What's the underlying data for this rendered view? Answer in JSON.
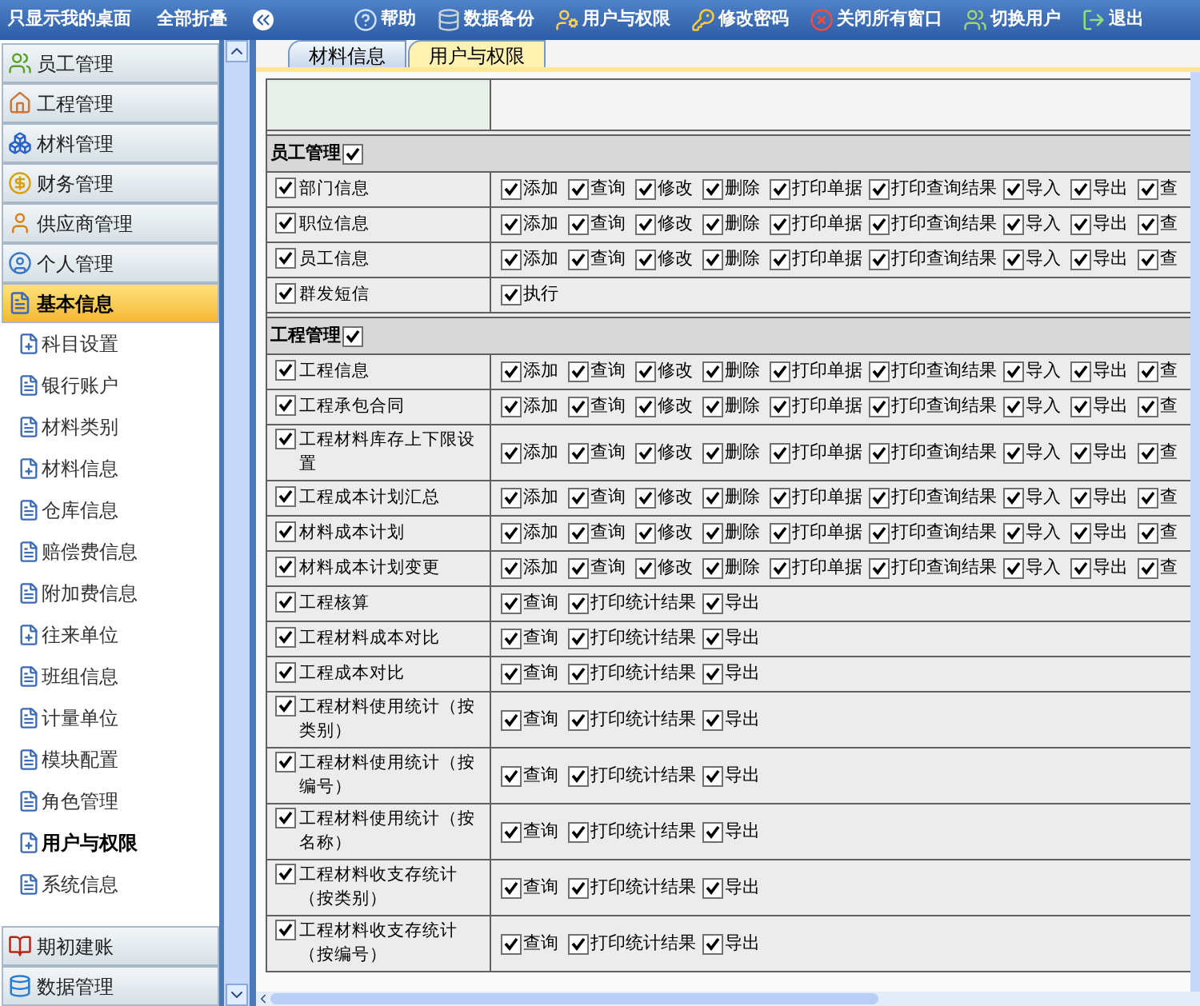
{
  "toolbar": {
    "left": [
      {
        "label": "只显示我的桌面"
      },
      {
        "label": "全部折叠"
      }
    ],
    "actions": [
      {
        "label": "帮助"
      },
      {
        "label": "数据备份"
      },
      {
        "label": "用户与权限"
      },
      {
        "label": "修改密码"
      },
      {
        "label": "关闭所有窗口"
      },
      {
        "label": "切换用户"
      },
      {
        "label": "退出"
      }
    ]
  },
  "sidebar": {
    "groups": [
      {
        "label": "员工管理",
        "expanded": false
      },
      {
        "label": "工程管理",
        "expanded": false
      },
      {
        "label": "材料管理",
        "expanded": false
      },
      {
        "label": "财务管理",
        "expanded": false
      },
      {
        "label": "供应商管理",
        "expanded": false
      },
      {
        "label": "个人管理",
        "expanded": false
      },
      {
        "label": "基本信息",
        "expanded": true,
        "children": [
          {
            "label": "科目设置",
            "kind": "doc-plus",
            "selected": false
          },
          {
            "label": "银行账户",
            "kind": "doc",
            "selected": false
          },
          {
            "label": "材料类别",
            "kind": "doc",
            "selected": false
          },
          {
            "label": "材料信息",
            "kind": "doc-plus",
            "selected": false
          },
          {
            "label": "仓库信息",
            "kind": "doc",
            "selected": false
          },
          {
            "label": "赔偿费信息",
            "kind": "doc",
            "selected": false
          },
          {
            "label": "附加费信息",
            "kind": "doc",
            "selected": false
          },
          {
            "label": "往来单位",
            "kind": "doc-plus",
            "selected": false
          },
          {
            "label": "班组信息",
            "kind": "doc",
            "selected": false
          },
          {
            "label": "计量单位",
            "kind": "doc",
            "selected": false
          },
          {
            "label": "模块配置",
            "kind": "doc",
            "selected": false
          },
          {
            "label": "角色管理",
            "kind": "doc",
            "selected": false
          },
          {
            "label": "用户与权限",
            "kind": "doc-plus",
            "selected": true
          },
          {
            "label": "系统信息",
            "kind": "doc",
            "selected": false
          }
        ]
      },
      {
        "label": "期初建账",
        "expanded": false
      },
      {
        "label": "数据管理",
        "expanded": false
      }
    ]
  },
  "tabs": [
    {
      "label": "材料信息",
      "selected": false
    },
    {
      "label": "用户与权限",
      "selected": true
    }
  ],
  "permissions": {
    "sections": [
      {
        "title": "员工管理",
        "checked": true,
        "rows": [
          {
            "label": "部门信息",
            "checked": true,
            "actions": [
              {
                "label": "添加",
                "checked": true
              },
              {
                "label": "查询",
                "checked": true
              },
              {
                "label": "修改",
                "checked": true
              },
              {
                "label": "删除",
                "checked": true
              },
              {
                "label": "打印单据",
                "checked": true
              },
              {
                "label": "打印查询结果",
                "checked": true
              },
              {
                "label": "导入",
                "checked": true
              },
              {
                "label": "导出",
                "checked": true
              },
              {
                "label": "查",
                "checked": true
              }
            ]
          },
          {
            "label": "职位信息",
            "checked": true,
            "actions": [
              {
                "label": "添加",
                "checked": true
              },
              {
                "label": "查询",
                "checked": true
              },
              {
                "label": "修改",
                "checked": true
              },
              {
                "label": "删除",
                "checked": true
              },
              {
                "label": "打印单据",
                "checked": true
              },
              {
                "label": "打印查询结果",
                "checked": true
              },
              {
                "label": "导入",
                "checked": true
              },
              {
                "label": "导出",
                "checked": true
              },
              {
                "label": "查",
                "checked": true
              }
            ]
          },
          {
            "label": "员工信息",
            "checked": true,
            "actions": [
              {
                "label": "添加",
                "checked": true
              },
              {
                "label": "查询",
                "checked": true
              },
              {
                "label": "修改",
                "checked": true
              },
              {
                "label": "删除",
                "checked": true
              },
              {
                "label": "打印单据",
                "checked": true
              },
              {
                "label": "打印查询结果",
                "checked": true
              },
              {
                "label": "导入",
                "checked": true
              },
              {
                "label": "导出",
                "checked": true
              },
              {
                "label": "查",
                "checked": true
              }
            ]
          },
          {
            "label": "群发短信",
            "checked": true,
            "actions": [
              {
                "label": "执行",
                "checked": true
              }
            ]
          }
        ]
      },
      {
        "title": "工程管理",
        "checked": true,
        "rows": [
          {
            "label": "工程信息",
            "checked": true,
            "actions": [
              {
                "label": "添加",
                "checked": true
              },
              {
                "label": "查询",
                "checked": true
              },
              {
                "label": "修改",
                "checked": true
              },
              {
                "label": "删除",
                "checked": true
              },
              {
                "label": "打印单据",
                "checked": true
              },
              {
                "label": "打印查询结果",
                "checked": true
              },
              {
                "label": "导入",
                "checked": true
              },
              {
                "label": "导出",
                "checked": true
              },
              {
                "label": "查",
                "checked": true
              }
            ]
          },
          {
            "label": "工程承包合同",
            "checked": true,
            "actions": [
              {
                "label": "添加",
                "checked": true
              },
              {
                "label": "查询",
                "checked": true
              },
              {
                "label": "修改",
                "checked": true
              },
              {
                "label": "删除",
                "checked": true
              },
              {
                "label": "打印单据",
                "checked": true
              },
              {
                "label": "打印查询结果",
                "checked": true
              },
              {
                "label": "导入",
                "checked": true
              },
              {
                "label": "导出",
                "checked": true
              },
              {
                "label": "查",
                "checked": true
              }
            ]
          },
          {
            "label": "工程材料库存上下限设置",
            "checked": true,
            "actions": [
              {
                "label": "添加",
                "checked": true
              },
              {
                "label": "查询",
                "checked": true
              },
              {
                "label": "修改",
                "checked": true
              },
              {
                "label": "删除",
                "checked": true
              },
              {
                "label": "打印单据",
                "checked": true
              },
              {
                "label": "打印查询结果",
                "checked": true
              },
              {
                "label": "导入",
                "checked": true
              },
              {
                "label": "导出",
                "checked": true
              },
              {
                "label": "查",
                "checked": true
              }
            ]
          },
          {
            "label": "工程成本计划汇总",
            "checked": true,
            "actions": [
              {
                "label": "添加",
                "checked": true
              },
              {
                "label": "查询",
                "checked": true
              },
              {
                "label": "修改",
                "checked": true
              },
              {
                "label": "删除",
                "checked": true
              },
              {
                "label": "打印单据",
                "checked": true
              },
              {
                "label": "打印查询结果",
                "checked": true
              },
              {
                "label": "导入",
                "checked": true
              },
              {
                "label": "导出",
                "checked": true
              },
              {
                "label": "查",
                "checked": true
              }
            ]
          },
          {
            "label": "材料成本计划",
            "checked": true,
            "actions": [
              {
                "label": "添加",
                "checked": true
              },
              {
                "label": "查询",
                "checked": true
              },
              {
                "label": "修改",
                "checked": true
              },
              {
                "label": "删除",
                "checked": true
              },
              {
                "label": "打印单据",
                "checked": true
              },
              {
                "label": "打印查询结果",
                "checked": true
              },
              {
                "label": "导入",
                "checked": true
              },
              {
                "label": "导出",
                "checked": true
              },
              {
                "label": "查",
                "checked": true
              }
            ]
          },
          {
            "label": "材料成本计划变更",
            "checked": true,
            "actions": [
              {
                "label": "添加",
                "checked": true
              },
              {
                "label": "查询",
                "checked": true
              },
              {
                "label": "修改",
                "checked": true
              },
              {
                "label": "删除",
                "checked": true
              },
              {
                "label": "打印单据",
                "checked": true
              },
              {
                "label": "打印查询结果",
                "checked": true
              },
              {
                "label": "导入",
                "checked": true
              },
              {
                "label": "导出",
                "checked": true
              },
              {
                "label": "查",
                "checked": true
              }
            ]
          },
          {
            "label": "工程核算",
            "checked": true,
            "actions": [
              {
                "label": "查询",
                "checked": true
              },
              {
                "label": "打印统计结果",
                "checked": true
              },
              {
                "label": "导出",
                "checked": true
              }
            ]
          },
          {
            "label": "工程材料成本对比",
            "checked": true,
            "actions": [
              {
                "label": "查询",
                "checked": true
              },
              {
                "label": "打印统计结果",
                "checked": true
              },
              {
                "label": "导出",
                "checked": true
              }
            ]
          },
          {
            "label": "工程成本对比",
            "checked": true,
            "actions": [
              {
                "label": "查询",
                "checked": true
              },
              {
                "label": "打印统计结果",
                "checked": true
              },
              {
                "label": "导出",
                "checked": true
              }
            ]
          },
          {
            "label": "工程材料使用统计（按类别）",
            "checked": true,
            "actions": [
              {
                "label": "查询",
                "checked": true
              },
              {
                "label": "打印统计结果",
                "checked": true
              },
              {
                "label": "导出",
                "checked": true
              }
            ]
          },
          {
            "label": "工程材料使用统计（按编号）",
            "checked": true,
            "actions": [
              {
                "label": "查询",
                "checked": true
              },
              {
                "label": "打印统计结果",
                "checked": true
              },
              {
                "label": "导出",
                "checked": true
              }
            ]
          },
          {
            "label": "工程材料使用统计（按名称）",
            "checked": true,
            "actions": [
              {
                "label": "查询",
                "checked": true
              },
              {
                "label": "打印统计结果",
                "checked": true
              },
              {
                "label": "导出",
                "checked": true
              }
            ]
          },
          {
            "label": "工程材料收支存统计（按类别）",
            "checked": true,
            "actions": [
              {
                "label": "查询",
                "checked": true
              },
              {
                "label": "打印统计结果",
                "checked": true
              },
              {
                "label": "导出",
                "checked": true
              }
            ]
          },
          {
            "label": "工程材料收支存统计（按编号）",
            "checked": true,
            "actions": [
              {
                "label": "查询",
                "checked": true
              },
              {
                "label": "打印统计结果",
                "checked": true
              },
              {
                "label": "导出",
                "checked": true
              }
            ]
          }
        ]
      }
    ]
  }
}
